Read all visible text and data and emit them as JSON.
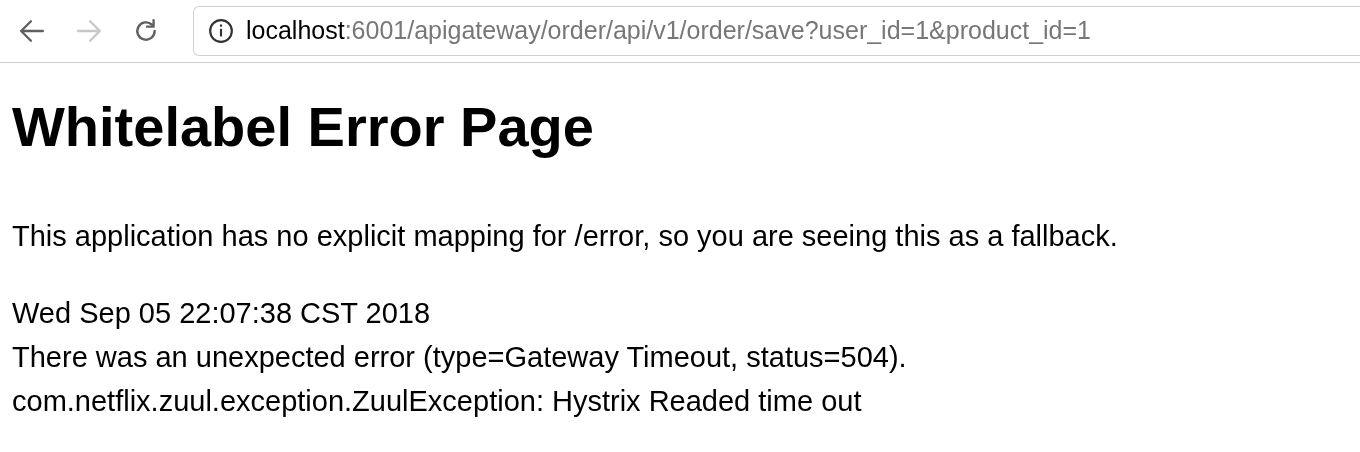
{
  "toolbar": {
    "nav_buttons": [
      {
        "kind": "back",
        "disabled": false
      },
      {
        "kind": "forward",
        "disabled": true
      },
      {
        "kind": "reload",
        "disabled": false
      }
    ],
    "address": {
      "host": "localhost",
      "path": ":6001/apigateway/order/api/v1/order/save?user_id=1&product_id=1"
    }
  },
  "page": {
    "heading": "Whitelabel Error Page",
    "message": "This application has no explicit mapping for /error, so you are seeing this as a fallback.",
    "details": [
      "Wed Sep 05 22:07:38 CST 2018",
      "There was an unexpected error (type=Gateway Timeout, status=504).",
      "com.netflix.zuul.exception.ZuulException: Hystrix Readed time out"
    ]
  }
}
